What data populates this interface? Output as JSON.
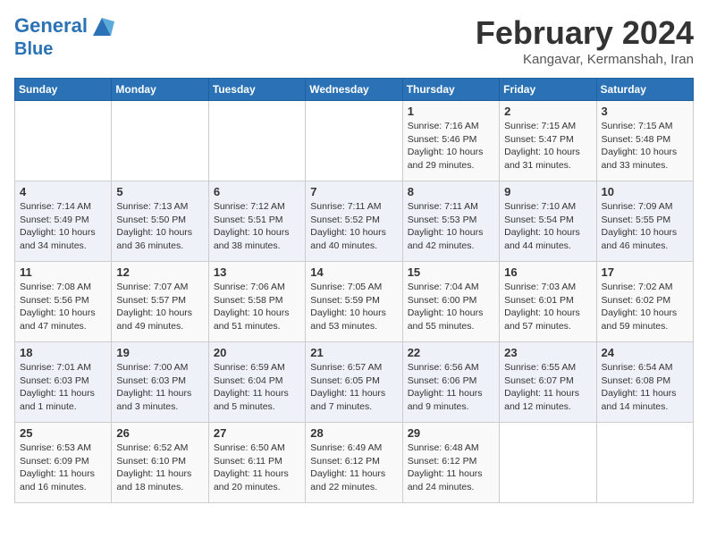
{
  "logo": {
    "line1": "General",
    "line2": "Blue"
  },
  "header": {
    "month": "February 2024",
    "location": "Kangavar, Kermanshah, Iran"
  },
  "weekdays": [
    "Sunday",
    "Monday",
    "Tuesday",
    "Wednesday",
    "Thursday",
    "Friday",
    "Saturday"
  ],
  "weeks": [
    [
      {
        "day": "",
        "info": ""
      },
      {
        "day": "",
        "info": ""
      },
      {
        "day": "",
        "info": ""
      },
      {
        "day": "",
        "info": ""
      },
      {
        "day": "1",
        "info": "Sunrise: 7:16 AM\nSunset: 5:46 PM\nDaylight: 10 hours\nand 29 minutes."
      },
      {
        "day": "2",
        "info": "Sunrise: 7:15 AM\nSunset: 5:47 PM\nDaylight: 10 hours\nand 31 minutes."
      },
      {
        "day": "3",
        "info": "Sunrise: 7:15 AM\nSunset: 5:48 PM\nDaylight: 10 hours\nand 33 minutes."
      }
    ],
    [
      {
        "day": "4",
        "info": "Sunrise: 7:14 AM\nSunset: 5:49 PM\nDaylight: 10 hours\nand 34 minutes."
      },
      {
        "day": "5",
        "info": "Sunrise: 7:13 AM\nSunset: 5:50 PM\nDaylight: 10 hours\nand 36 minutes."
      },
      {
        "day": "6",
        "info": "Sunrise: 7:12 AM\nSunset: 5:51 PM\nDaylight: 10 hours\nand 38 minutes."
      },
      {
        "day": "7",
        "info": "Sunrise: 7:11 AM\nSunset: 5:52 PM\nDaylight: 10 hours\nand 40 minutes."
      },
      {
        "day": "8",
        "info": "Sunrise: 7:11 AM\nSunset: 5:53 PM\nDaylight: 10 hours\nand 42 minutes."
      },
      {
        "day": "9",
        "info": "Sunrise: 7:10 AM\nSunset: 5:54 PM\nDaylight: 10 hours\nand 44 minutes."
      },
      {
        "day": "10",
        "info": "Sunrise: 7:09 AM\nSunset: 5:55 PM\nDaylight: 10 hours\nand 46 minutes."
      }
    ],
    [
      {
        "day": "11",
        "info": "Sunrise: 7:08 AM\nSunset: 5:56 PM\nDaylight: 10 hours\nand 47 minutes."
      },
      {
        "day": "12",
        "info": "Sunrise: 7:07 AM\nSunset: 5:57 PM\nDaylight: 10 hours\nand 49 minutes."
      },
      {
        "day": "13",
        "info": "Sunrise: 7:06 AM\nSunset: 5:58 PM\nDaylight: 10 hours\nand 51 minutes."
      },
      {
        "day": "14",
        "info": "Sunrise: 7:05 AM\nSunset: 5:59 PM\nDaylight: 10 hours\nand 53 minutes."
      },
      {
        "day": "15",
        "info": "Sunrise: 7:04 AM\nSunset: 6:00 PM\nDaylight: 10 hours\nand 55 minutes."
      },
      {
        "day": "16",
        "info": "Sunrise: 7:03 AM\nSunset: 6:01 PM\nDaylight: 10 hours\nand 57 minutes."
      },
      {
        "day": "17",
        "info": "Sunrise: 7:02 AM\nSunset: 6:02 PM\nDaylight: 10 hours\nand 59 minutes."
      }
    ],
    [
      {
        "day": "18",
        "info": "Sunrise: 7:01 AM\nSunset: 6:03 PM\nDaylight: 11 hours\nand 1 minute."
      },
      {
        "day": "19",
        "info": "Sunrise: 7:00 AM\nSunset: 6:03 PM\nDaylight: 11 hours\nand 3 minutes."
      },
      {
        "day": "20",
        "info": "Sunrise: 6:59 AM\nSunset: 6:04 PM\nDaylight: 11 hours\nand 5 minutes."
      },
      {
        "day": "21",
        "info": "Sunrise: 6:57 AM\nSunset: 6:05 PM\nDaylight: 11 hours\nand 7 minutes."
      },
      {
        "day": "22",
        "info": "Sunrise: 6:56 AM\nSunset: 6:06 PM\nDaylight: 11 hours\nand 9 minutes."
      },
      {
        "day": "23",
        "info": "Sunrise: 6:55 AM\nSunset: 6:07 PM\nDaylight: 11 hours\nand 12 minutes."
      },
      {
        "day": "24",
        "info": "Sunrise: 6:54 AM\nSunset: 6:08 PM\nDaylight: 11 hours\nand 14 minutes."
      }
    ],
    [
      {
        "day": "25",
        "info": "Sunrise: 6:53 AM\nSunset: 6:09 PM\nDaylight: 11 hours\nand 16 minutes."
      },
      {
        "day": "26",
        "info": "Sunrise: 6:52 AM\nSunset: 6:10 PM\nDaylight: 11 hours\nand 18 minutes."
      },
      {
        "day": "27",
        "info": "Sunrise: 6:50 AM\nSunset: 6:11 PM\nDaylight: 11 hours\nand 20 minutes."
      },
      {
        "day": "28",
        "info": "Sunrise: 6:49 AM\nSunset: 6:12 PM\nDaylight: 11 hours\nand 22 minutes."
      },
      {
        "day": "29",
        "info": "Sunrise: 6:48 AM\nSunset: 6:12 PM\nDaylight: 11 hours\nand 24 minutes."
      },
      {
        "day": "",
        "info": ""
      },
      {
        "day": "",
        "info": ""
      }
    ]
  ]
}
